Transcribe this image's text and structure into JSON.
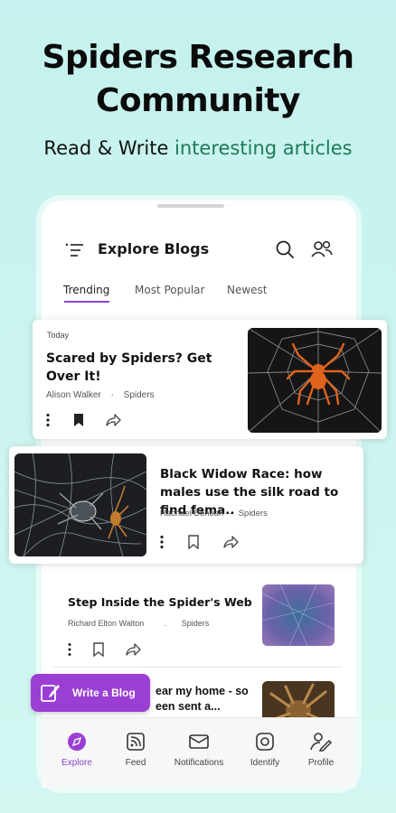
{
  "hero": {
    "title_line1": "Spiders Research",
    "title_line2": "Community",
    "subtitle_plain": "Read & Write ",
    "subtitle_accent": "interesting articles"
  },
  "app": {
    "title": "Explore Blogs",
    "tabs": [
      {
        "label": "Trending",
        "active": true
      },
      {
        "label": "Most Popular",
        "active": false
      },
      {
        "label": "Newest",
        "active": false
      }
    ]
  },
  "articles": [
    {
      "date": "Today",
      "title": "Scared by Spiders? Get Over It!",
      "author": "Alison Walker",
      "separator": "·",
      "category": "Spiders",
      "bookmarked": true
    },
    {
      "title": "Black Widow Race: how males use the silk road to find fema..",
      "author": "Rachael Bonoan",
      "separator": "·",
      "category": "Spiders",
      "bookmarked": false
    },
    {
      "title": "Step Inside the Spider's Web",
      "author": "Richard Elton Walton",
      "separator": ".",
      "category": "Spiders",
      "bookmarked": false
    },
    {
      "title_partial1": "ear my home - so",
      "title_partial2": "een sent a..."
    }
  ],
  "fab": {
    "label": "Write a Blog"
  },
  "bottom_nav": [
    {
      "label": "Explore",
      "icon": "explore-icon",
      "active": true
    },
    {
      "label": "Feed",
      "icon": "feed-icon",
      "active": false
    },
    {
      "label": "Notifications",
      "icon": "notifications-icon",
      "active": false
    },
    {
      "label": "Identify",
      "icon": "identify-icon",
      "active": false
    },
    {
      "label": "Profile",
      "icon": "profile-icon",
      "active": false
    }
  ],
  "colors": {
    "accent": "#8e44d6",
    "fab": "#9b3fd4",
    "subtitle_accent": "#1f7a58",
    "background": "#c9f3ef"
  }
}
